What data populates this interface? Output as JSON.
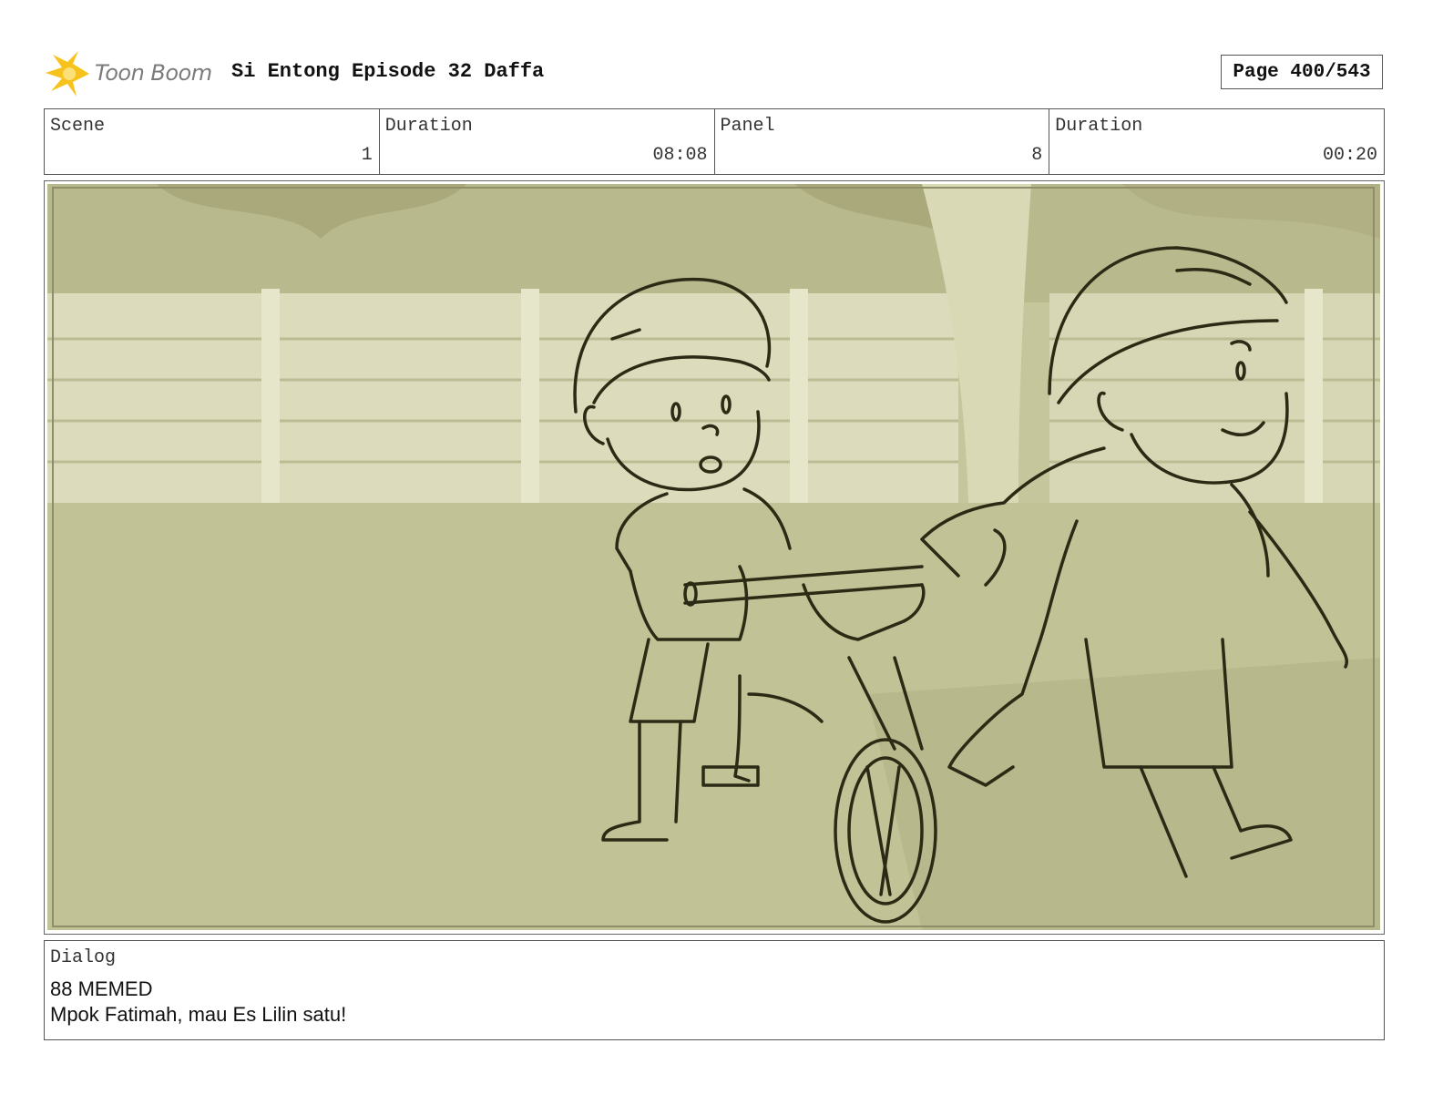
{
  "header": {
    "logo_text": "Toon Boom",
    "title": "Si Entong Episode 32 Daffa",
    "page": "Page 400/543"
  },
  "info": {
    "scene_label": "Scene",
    "scene_value": "1",
    "scene_duration_label": "Duration",
    "scene_duration_value": "08:08",
    "panel_label": "Panel",
    "panel_value": "8",
    "panel_duration_label": "Duration",
    "panel_duration_value": "00:20"
  },
  "dialog": {
    "label": "Dialog",
    "line1": "88 MEMED",
    "line2": "Mpok Fatimah, mau Es Lilin satu!"
  },
  "colors": {
    "logo_accent": "#f7c21b",
    "panel_bg": "#c9c9a1",
    "sketch_line": "#2b2a14"
  }
}
